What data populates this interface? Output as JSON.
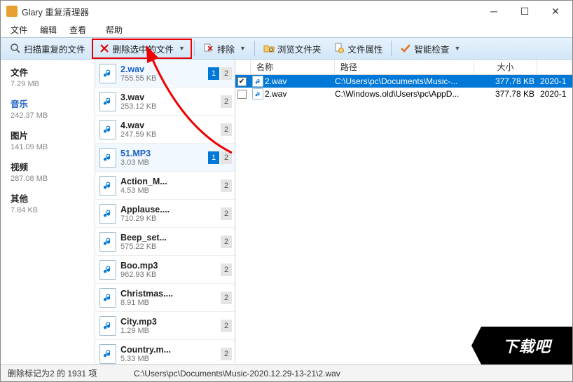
{
  "window": {
    "title": "Glary 重复清理器"
  },
  "menu": {
    "file": "文件",
    "edit": "编辑",
    "view": "查看",
    "help": "帮助"
  },
  "toolbar": {
    "scan": "扫描重复的文件",
    "delete_selected": "删除选中的文件",
    "exclude": "排除",
    "browse": "浏览文件夹",
    "properties": "文件属性",
    "smart_check": "智能检查"
  },
  "sidebar": [
    {
      "name": "文件",
      "size": "7.29 MB"
    },
    {
      "name": "音乐",
      "size": "242.37 MB"
    },
    {
      "name": "图片",
      "size": "141.09 MB"
    },
    {
      "name": "视频",
      "size": "287.08 MB"
    },
    {
      "name": "其他",
      "size": "7.84 KB"
    }
  ],
  "files": [
    {
      "name": "2.wav",
      "size": "755.55 KB",
      "b1": true,
      "b2": true,
      "sel": true
    },
    {
      "name": "3.wav",
      "size": "253.12 KB",
      "b1": false,
      "b2": true,
      "sel": false
    },
    {
      "name": "4.wav",
      "size": "247.59 KB",
      "b1": false,
      "b2": true,
      "sel": false
    },
    {
      "name": "51.MP3",
      "size": "3.03 MB",
      "b1": true,
      "b2": true,
      "sel": true
    },
    {
      "name": "Action_M...",
      "size": "4.53 MB",
      "b1": false,
      "b2": true,
      "sel": false
    },
    {
      "name": "Applause....",
      "size": "710.29 KB",
      "b1": false,
      "b2": true,
      "sel": false
    },
    {
      "name": "Beep_set...",
      "size": "575.22 KB",
      "b1": false,
      "b2": true,
      "sel": false
    },
    {
      "name": "Boo.mp3",
      "size": "962.93 KB",
      "b1": false,
      "b2": true,
      "sel": false
    },
    {
      "name": "Christmas....",
      "size": "8.91 MB",
      "b1": false,
      "b2": true,
      "sel": false
    },
    {
      "name": "City.mp3",
      "size": "1.29 MB",
      "b1": false,
      "b2": true,
      "sel": false
    },
    {
      "name": "Country.m...",
      "size": "5.33 MB",
      "b1": false,
      "b2": true,
      "sel": false
    }
  ],
  "detail": {
    "headers": {
      "name": "名称",
      "path": "路径",
      "size": "大小"
    },
    "rows": [
      {
        "checked": true,
        "name": "2.wav",
        "path": "C:\\Users\\pc\\Documents\\Music-...",
        "size": "377.78 KB",
        "date": "2020-1",
        "sel": true
      },
      {
        "checked": false,
        "name": "2.wav",
        "path": "C:\\Windows.old\\Users\\pc\\AppD...",
        "size": "377.78 KB",
        "date": "2020-1",
        "sel": false
      }
    ]
  },
  "status": {
    "left": "删除标记为2 的 1931 项",
    "path": "C:\\Users\\pc\\Documents\\Music-2020.12.29-13-21\\2.wav"
  },
  "watermark": "下载吧"
}
